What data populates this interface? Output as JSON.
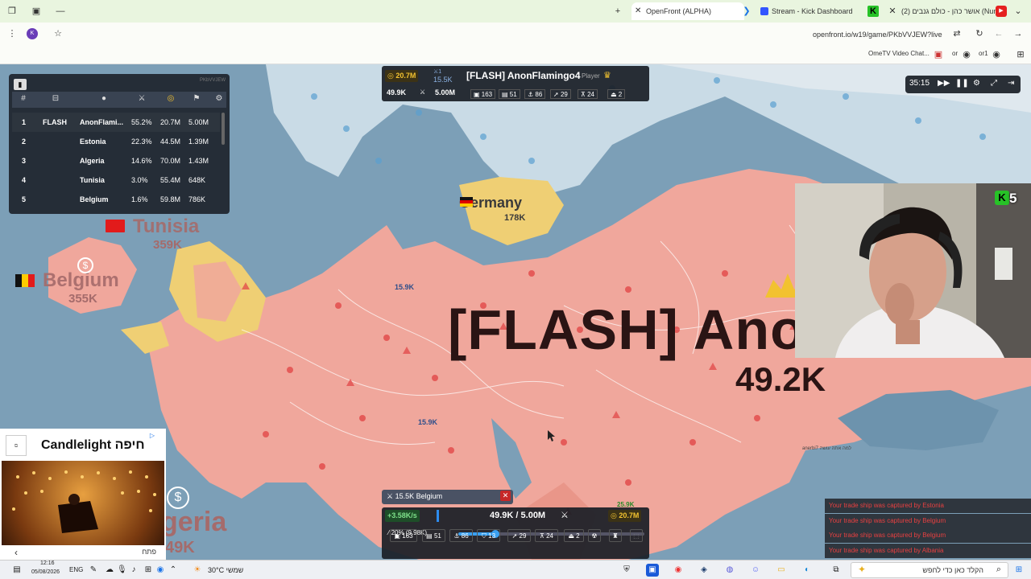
{
  "browser": {
    "tabs": [
      {
        "label": "OpenFront (ALPHA)",
        "active": true,
        "fav_color": "#e53935"
      },
      {
        "label": "Stream - Kick Dashboard",
        "active": false,
        "fav_color": "#3355ff"
      },
      {
        "label": "(2) אושר כהן - כולם גנבים (Nuni)",
        "active": false,
        "fav_color": "#ff0000"
      }
    ],
    "url": "openfront.io/w19/game/PKbVVJEW?live",
    "bookmarks": [
      "OmeTV Video Chat...",
      "or",
      "or1"
    ]
  },
  "leaderboard": {
    "watermark": "PKbVVJEW",
    "headers": [
      "#",
      "clan-icon",
      "player-icon",
      "troops-icon",
      "gold-icon",
      "max-troops-icon",
      "settings-icon"
    ],
    "rows": [
      {
        "rank": "1",
        "clan": "FLASH",
        "name": "AnonFlami...",
        "land": "55.2%",
        "gold": "20.7M",
        "troops": "5.00M"
      },
      {
        "rank": "2",
        "clan": "",
        "name": "Estonia",
        "land": "22.3%",
        "gold": "44.5M",
        "troops": "1.39M"
      },
      {
        "rank": "3",
        "clan": "",
        "name": "Algeria",
        "land": "14.6%",
        "gold": "70.0M",
        "troops": "1.43M"
      },
      {
        "rank": "4",
        "clan": "",
        "name": "Tunisia",
        "land": "3.0%",
        "gold": "55.4M",
        "troops": "648K"
      },
      {
        "rank": "5",
        "clan": "",
        "name": "Belgium",
        "land": "1.6%",
        "gold": "59.8M",
        "troops": "786K"
      }
    ]
  },
  "player_bar": {
    "gold": "20.7M",
    "troops_small": "15.5K",
    "name": "[FLASH] AnonFlamingo4",
    "type": "Player",
    "current": "49.9K",
    "max": "5.00M",
    "stats": [
      "163",
      "51",
      "86",
      "29",
      "24",
      "2"
    ]
  },
  "timer": {
    "time": "35:15"
  },
  "map_labels": {
    "germany": {
      "name": "Germany",
      "pop": "178K"
    },
    "tunisia": {
      "name": "Tunisia",
      "pop": "359K"
    },
    "belgium": {
      "name": "Belgium",
      "pop": "355K"
    },
    "algeria": {
      "name": "geria",
      "pop": "49K"
    },
    "flash_big": "[FLASH] Ano",
    "flash_pop": "49.2K",
    "unit1": "15.9K",
    "unit2": "15.9K",
    "tiny_label": "למה אתה עושה",
    "tiny_label2": "anerbi7",
    "ship_troops": "25.9K"
  },
  "control": {
    "selected": "15.5K  Belgium",
    "rate": "+3.58K/s",
    "troops": "49.9K / 5.00M",
    "gold": "20.7M",
    "ratio": "20% (9.98K)",
    "ratio_value": 0.2,
    "build": [
      "163",
      "51",
      "86",
      "13",
      "29",
      "24",
      "2"
    ]
  },
  "stream": {
    "viewers": "5"
  },
  "ad": {
    "title": "Candlelight חיפה",
    "cta": "פתח"
  },
  "toasts": [
    "Your trade ship was captured by Estonia",
    "Your trade ship was captured by Belgium",
    "Your trade ship was captured by Belgium",
    "Your trade ship was captured by Albania"
  ],
  "taskbar": {
    "time": "12:16",
    "date": "05/08/2026",
    "lang": "ENG",
    "weather": "30°C",
    "weather_label": "שמשי",
    "search_placeholder": "הקלד כאן כדי לחפש"
  },
  "colors": {
    "player": "#f0a79c",
    "ally": "#efcf74",
    "sea": "#7c9fb7",
    "panel": "#1c222b",
    "gold": "#f2c230"
  }
}
